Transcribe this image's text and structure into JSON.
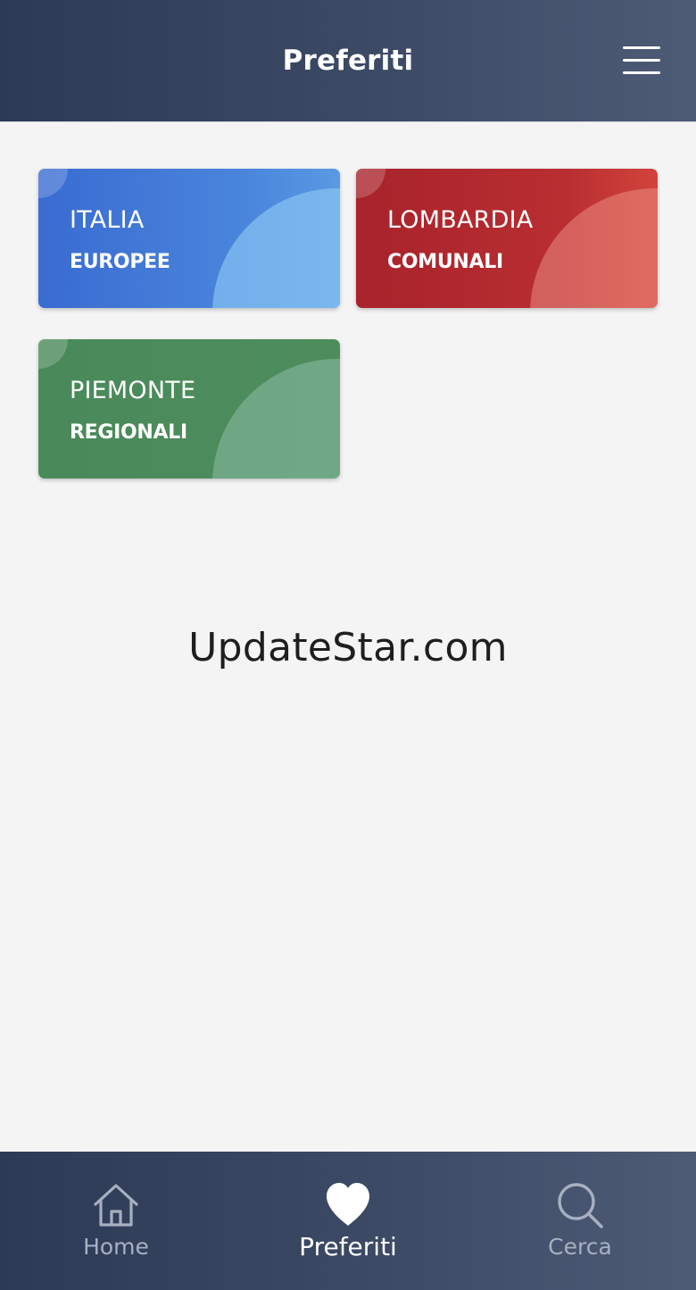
{
  "header": {
    "title": "Preferiti",
    "menu_icon": "hamburger-menu-icon"
  },
  "favorites": [
    {
      "name": "ITALIA",
      "type": "EUROPEE",
      "color": "#3f74d6"
    },
    {
      "name": "LOMBARDIA",
      "type": "COMUNALI",
      "color": "#b12a30"
    },
    {
      "name": "PIEMONTE",
      "type": "REGIONALI",
      "color": "#4c8b5b"
    }
  ],
  "watermark": "UpdateStar.com",
  "bottom_nav": {
    "home": {
      "label": "Home",
      "icon": "home-icon"
    },
    "favorites": {
      "label": "Preferiti",
      "icon": "heart-icon",
      "active": true
    },
    "search": {
      "label": "Cerca",
      "icon": "search-icon"
    }
  },
  "colors": {
    "nav_bg": "#34425e",
    "active_label": "#ffffff",
    "inactive_label": "#a7b0c1",
    "page_bg": "#f4f4f4"
  }
}
